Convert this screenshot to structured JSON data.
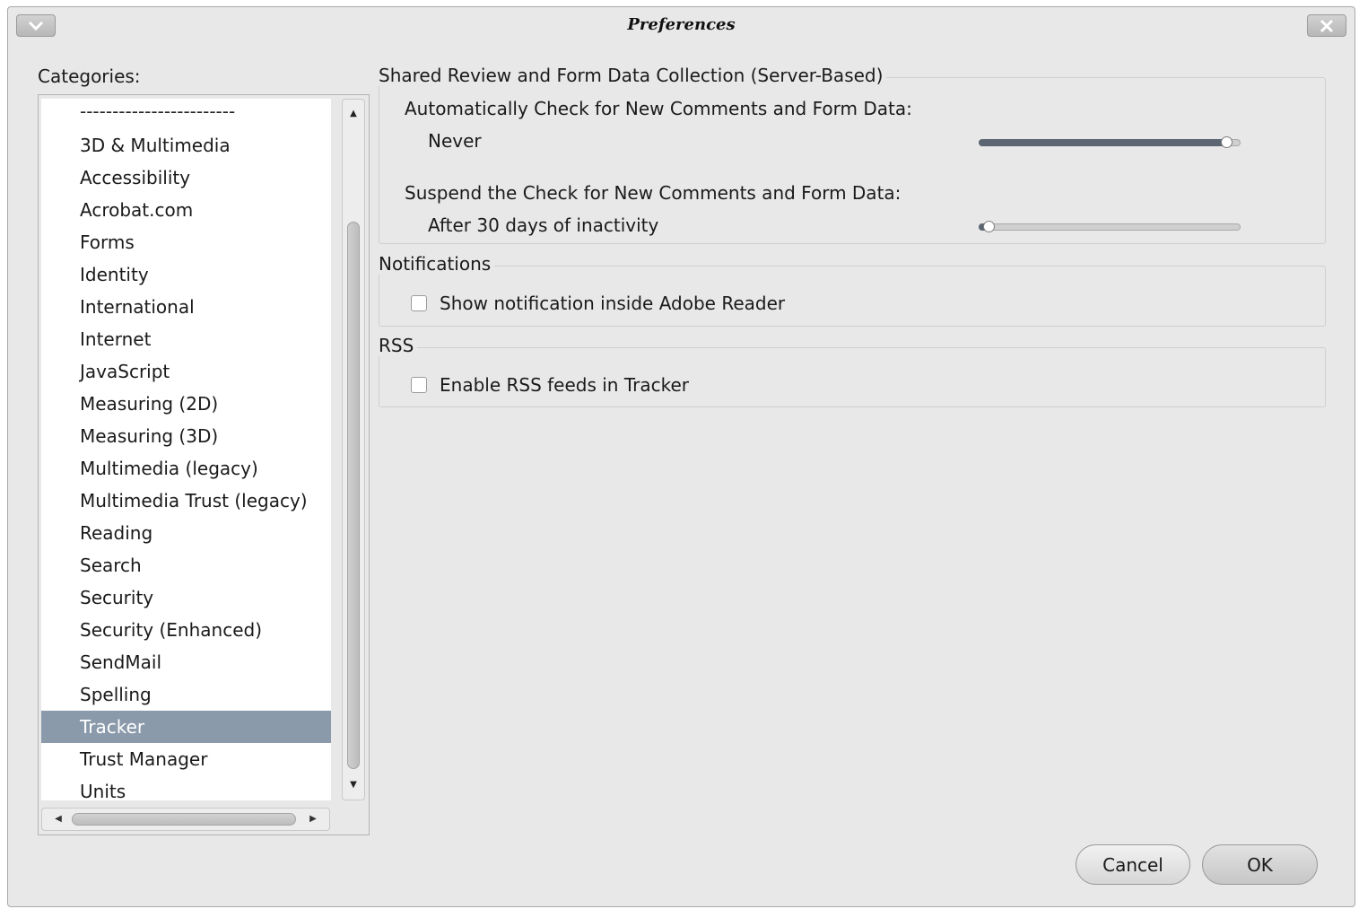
{
  "window": {
    "title": "Preferences"
  },
  "categories": {
    "label": "Categories:",
    "items": [
      "------------------------",
      "3D & Multimedia",
      "Accessibility",
      "Acrobat.com",
      "Forms",
      "Identity",
      "International",
      "Internet",
      "JavaScript",
      "Measuring (2D)",
      "Measuring (3D)",
      "Multimedia (legacy)",
      "Multimedia Trust (legacy)",
      "Reading",
      "Search",
      "Security",
      "Security (Enhanced)",
      "SendMail",
      "Spelling",
      "Tracker",
      "Trust Manager",
      "Units"
    ],
    "selected": "Tracker"
  },
  "shared_review": {
    "title": "Shared Review and Form Data Collection (Server-Based)",
    "auto_check_label": "Automatically Check for New Comments and Form Data:",
    "auto_check_value": "Never",
    "auto_check_level": 0.95,
    "suspend_label": "Suspend the Check for New Comments and Form Data:",
    "suspend_value": "After 30 days of inactivity",
    "suspend_level": 0.04
  },
  "notifications": {
    "title": "Notifications",
    "show_notification_label": "Show notification inside Adobe Reader",
    "show_notification_checked": false
  },
  "rss": {
    "title": "RSS",
    "enable_rss_label": "Enable RSS feeds in Tracker",
    "enable_rss_checked": false
  },
  "buttons": {
    "cancel": "Cancel",
    "ok": "OK"
  }
}
